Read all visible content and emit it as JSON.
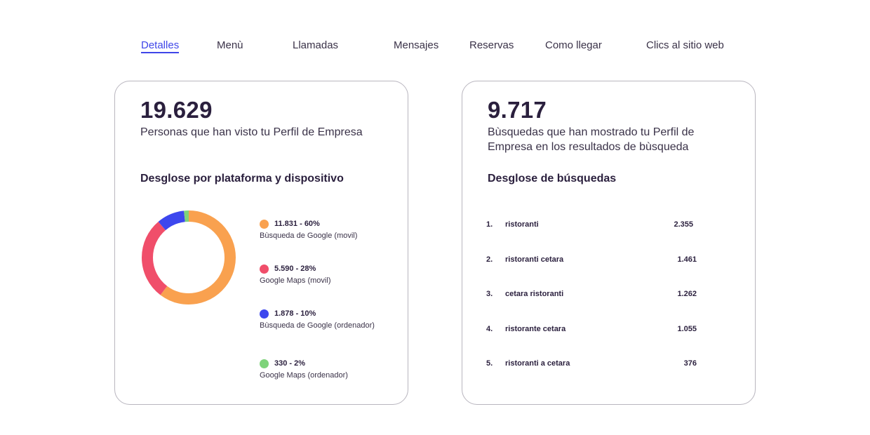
{
  "tabs": [
    {
      "label": "Detalles",
      "active": true
    },
    {
      "label": "Menù",
      "active": false
    },
    {
      "label": "Llamadas",
      "active": false
    },
    {
      "label": "Mensajes",
      "active": false
    },
    {
      "label": "Reservas",
      "active": false
    },
    {
      "label": "Como llegar",
      "active": false
    },
    {
      "label": "Clics al sitio web",
      "active": false
    }
  ],
  "profile_views": {
    "number": "19.629",
    "description": "Personas que han visto tu Perfil de Empresa",
    "breakdown_title": "Desglose por plataforma y dispositivo",
    "legend": [
      {
        "value": "11.831 - 60%",
        "label": "Bùsqueda de Google (movil)",
        "color": "#F9A14F"
      },
      {
        "value": "5.590 - 28%",
        "label": "Google Maps (movil)",
        "color": "#F04E6A"
      },
      {
        "value": "1.878 - 10%",
        "label": "Bùsqueda de Google (ordenador)",
        "color": "#3D47EE"
      },
      {
        "value": "330 - 2%",
        "label": "Google Maps (ordenador)",
        "color": "#7ED37A"
      }
    ]
  },
  "chart_data": {
    "type": "pie",
    "donut": true,
    "categories": [
      "Bùsqueda de Google (movil)",
      "Google Maps (movil)",
      "Bùsqueda de Google (ordenador)",
      "Google Maps (ordenador)"
    ],
    "values": [
      11831,
      5590,
      1878,
      330
    ],
    "percentages": [
      60,
      28,
      10,
      2
    ],
    "colors": [
      "#F9A14F",
      "#F04E6A",
      "#3D47EE",
      "#7ED37A"
    ],
    "legend_position": "right"
  },
  "searches": {
    "number": "9.717",
    "description": "Bùsquedas que han mostrado tu Perfil de Empresa en los resultados de bùsqueda",
    "breakdown_title": "Desglose de búsquedas",
    "rows": [
      {
        "rank": "1.",
        "term": "ristoranti",
        "count": "2.355"
      },
      {
        "rank": "2.",
        "term": "ristoranti cetara",
        "count": "1.461"
      },
      {
        "rank": "3.",
        "term": "cetara ristoranti",
        "count": "1.262"
      },
      {
        "rank": "4.",
        "term": "ristorante cetara",
        "count": "1.055"
      },
      {
        "rank": "5.",
        "term": "ristoranti a cetara",
        "count": "376"
      }
    ]
  }
}
